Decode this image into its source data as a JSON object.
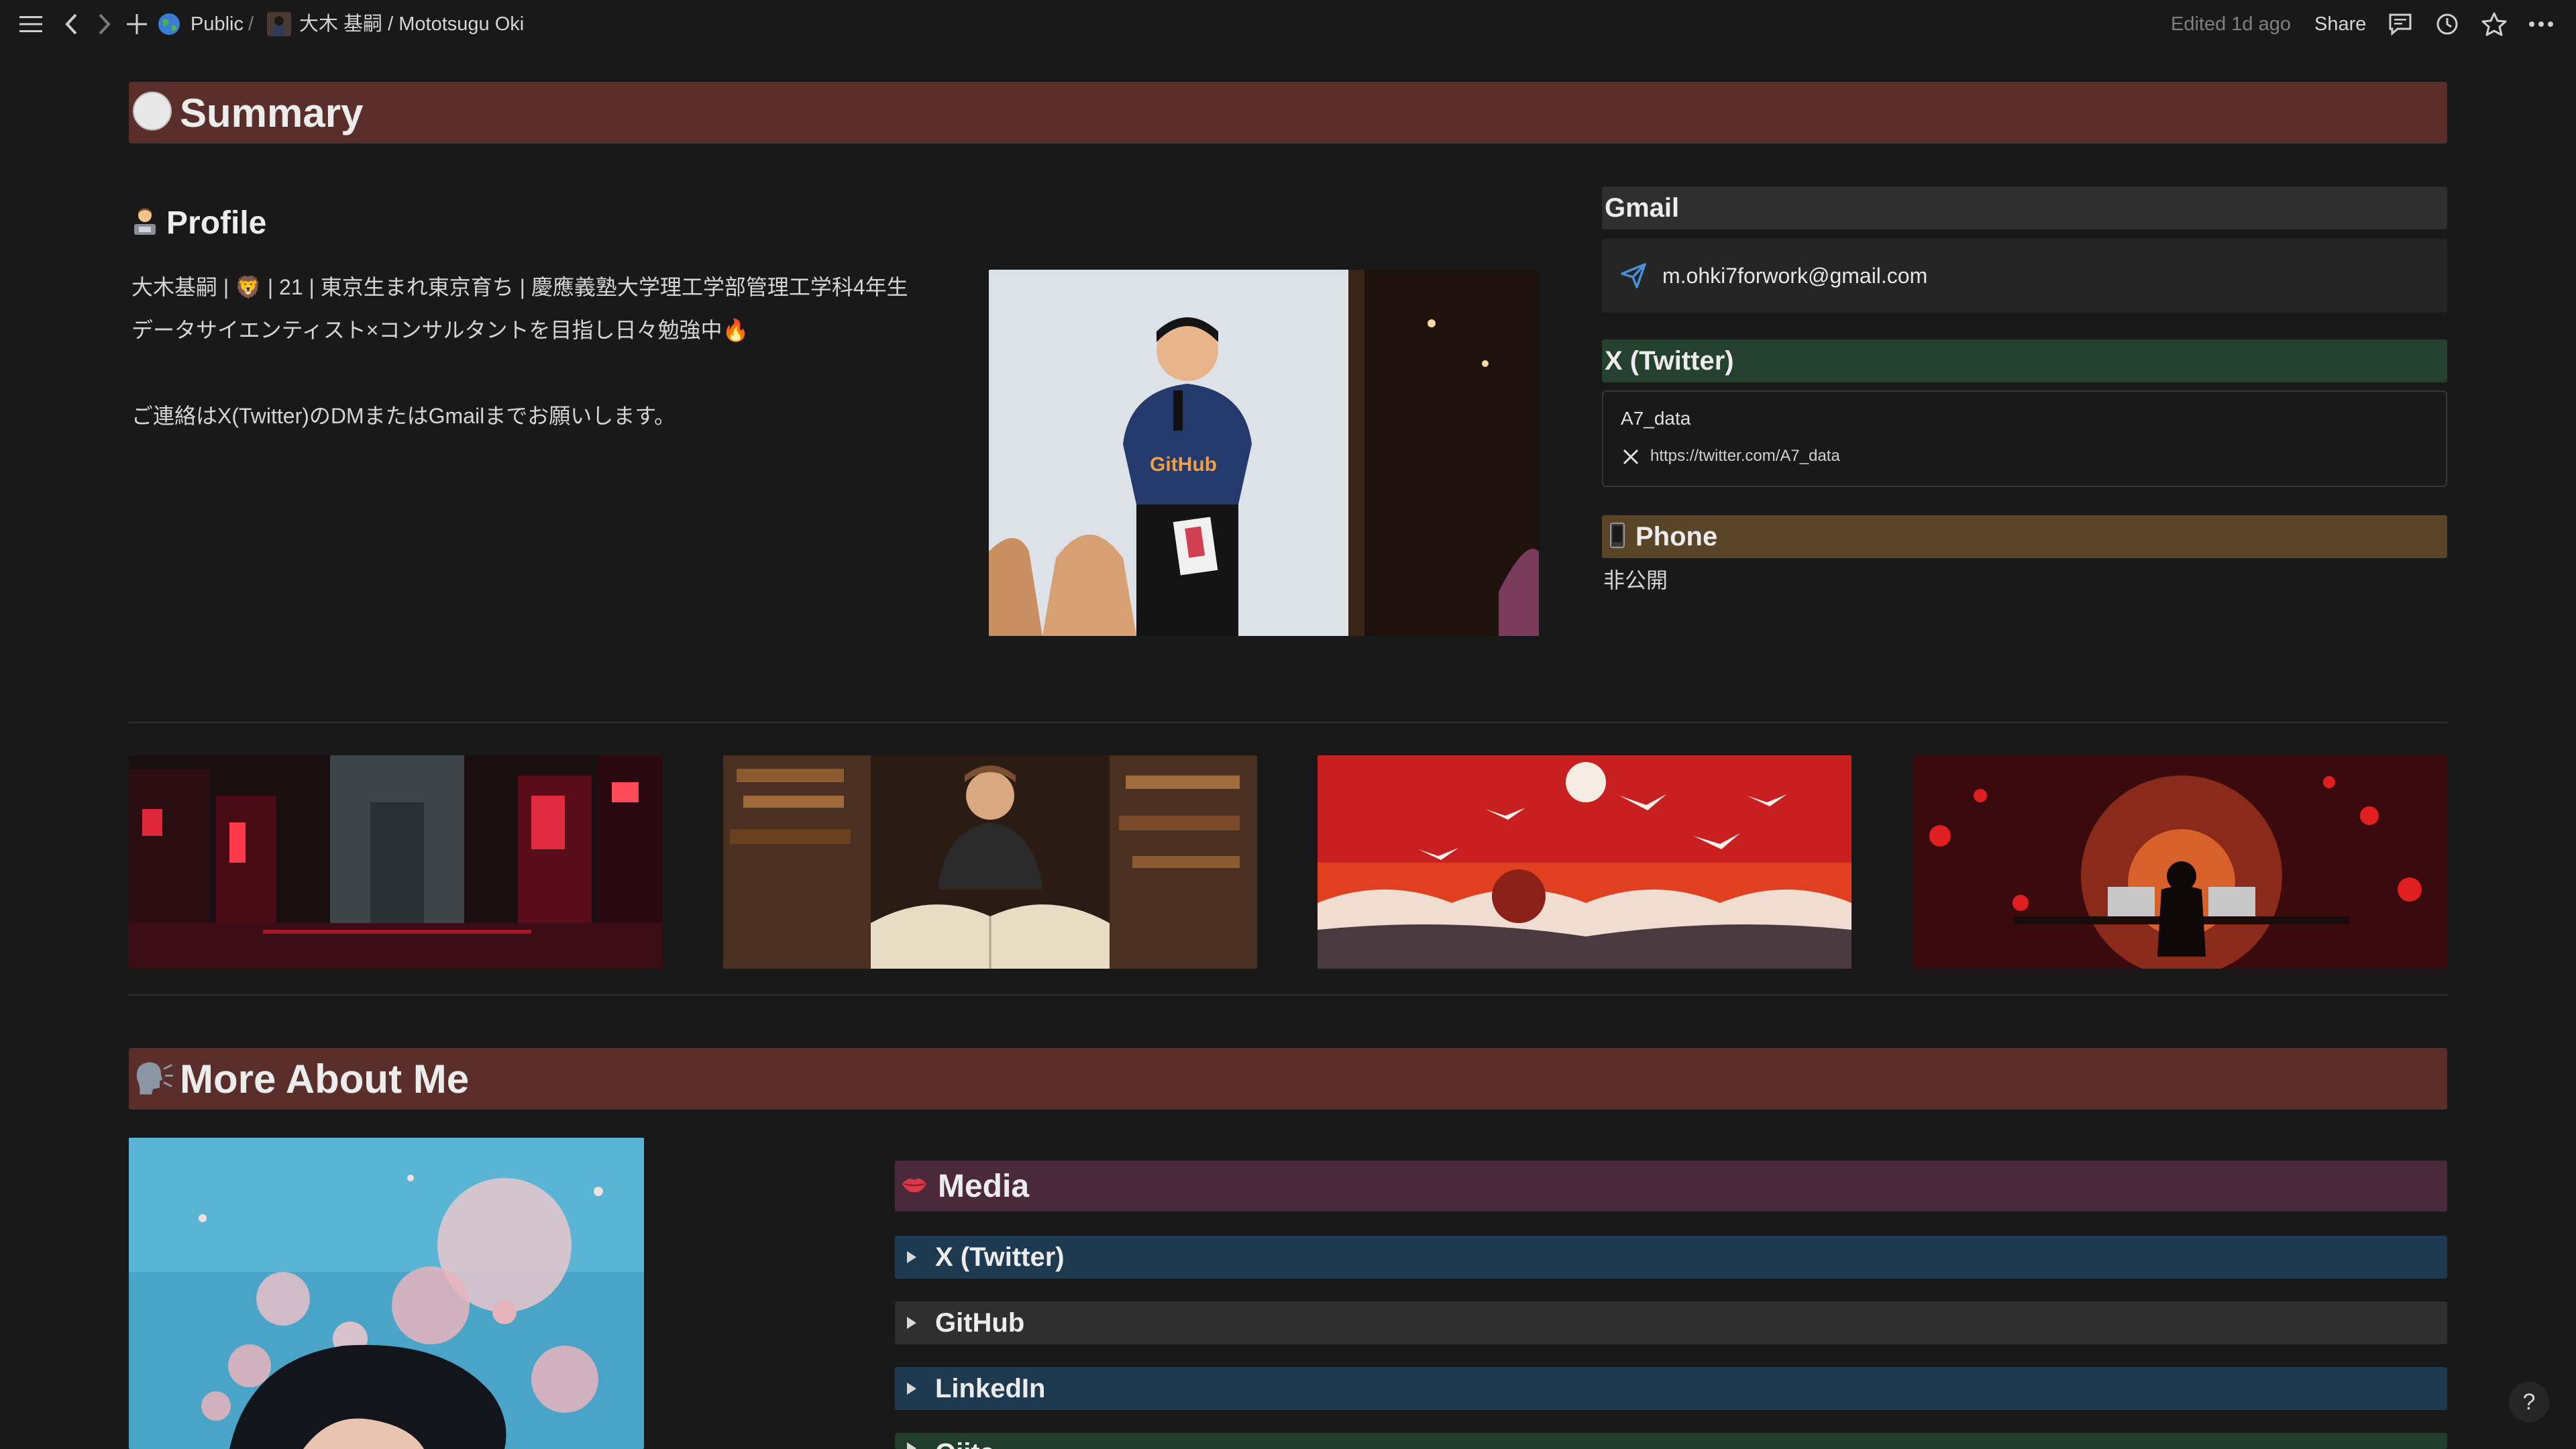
{
  "topbar": {
    "breadcrumb_public": "Public",
    "breadcrumb_sep": "/",
    "breadcrumb_page": "大木 基嗣 / Mototsugu Oki",
    "edited": "Edited 1d ago",
    "share_label": "Share"
  },
  "summary": {
    "title": "Summary",
    "profile_heading": "Profile",
    "profile_line1": "大木基嗣 | 🦁 | 21 | 東京生まれ東京育ち | 慶應義塾大学理工学部管理工学科4年生",
    "profile_line2": "データサイエンティスト×コンサルタントを目指し日々勉強中🔥",
    "profile_line3": "ご連絡はX(Twitter)のDMまたはGmailまでお願いします。"
  },
  "contacts": {
    "gmail_heading": "Gmail",
    "gmail_address": "m.ohki7forwork@gmail.com",
    "twitter_heading": "X (Twitter)",
    "twitter_handle": "A7_data",
    "twitter_url": "https://twitter.com/A7_data",
    "phone_heading": "Phone",
    "phone_value": "非公開"
  },
  "more": {
    "title": "More About Me",
    "media_heading": "Media",
    "toggles": [
      "X (Twitter)",
      "GitHub",
      "LinkedIn",
      "Qiita"
    ]
  },
  "colors": {
    "bg": "#191919",
    "summary_band": "#5a2e2a",
    "gmail_band": "#2f2f2f",
    "twitter_band": "#24402f",
    "phone_band": "#5a4427",
    "media_band": "#4a2a3a",
    "toggle_blue": "#1d3a50",
    "toggle_gray": "#2f2f2f",
    "toggle_green": "#213d2c"
  },
  "help_label": "?"
}
